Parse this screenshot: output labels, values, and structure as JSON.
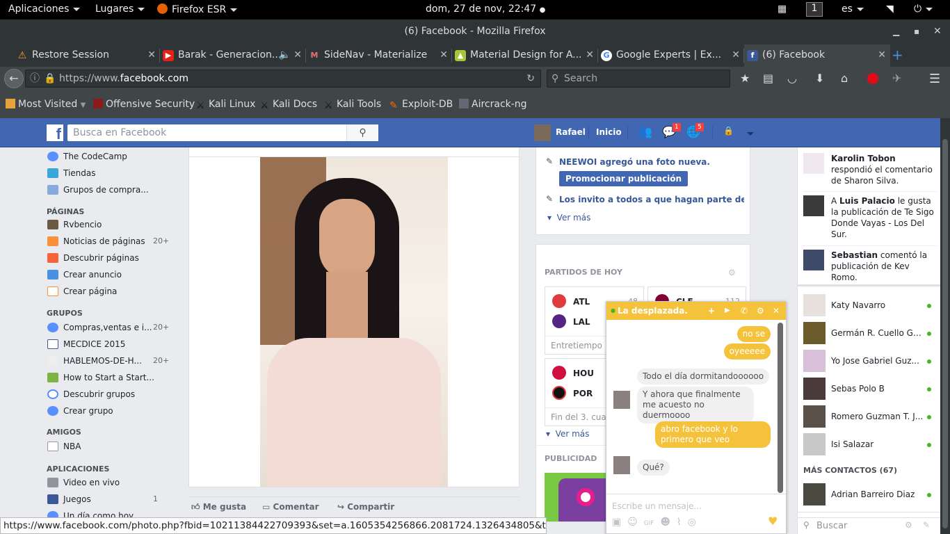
{
  "topbar": {
    "applications": "Aplicaciones",
    "places": "Lugares",
    "firefox": "Firefox ESR",
    "clock": "dom, 27 de nov, 22:47",
    "workspace": "1",
    "lang": "es"
  },
  "window": {
    "title": "(6) Facebook - Mozilla Firefox"
  },
  "tabs": [
    {
      "label": "Restore Session"
    },
    {
      "label": "Barak - Generacion..."
    },
    {
      "label": "SideNav - Materialize"
    },
    {
      "label": "Material Design for A..."
    },
    {
      "label": "Google Experts  |  Ex..."
    },
    {
      "label": "(6) Facebook"
    }
  ],
  "nav": {
    "url_prefix": "https://www.",
    "url_domain": "facebook.com",
    "search_placeholder": "Search"
  },
  "bookmarks": [
    {
      "label": "Most Visited"
    },
    {
      "label": "Offensive Security"
    },
    {
      "label": "Kali Linux"
    },
    {
      "label": "Kali Docs"
    },
    {
      "label": "Kali Tools"
    },
    {
      "label": "Exploit-DB"
    },
    {
      "label": "Aircrack-ng"
    }
  ],
  "fb": {
    "search_placeholder": "Busca en Facebook",
    "user": "Rafael",
    "home": "Inicio",
    "badge_messages": "1",
    "badge_notifications": "5"
  },
  "left": {
    "items_top": [
      {
        "label": "The CodeCamp",
        "count": ""
      },
      {
        "label": "Tiendas",
        "count": ""
      },
      {
        "label": "Grupos de compra...",
        "count": ""
      }
    ],
    "pages_header": "PÁGINAS",
    "pages": [
      {
        "label": "Rvbencio",
        "count": ""
      },
      {
        "label": "Noticias de páginas",
        "count": "20+"
      },
      {
        "label": "Descubrir páginas",
        "count": ""
      },
      {
        "label": "Crear anuncio",
        "count": ""
      },
      {
        "label": "Crear página",
        "count": ""
      }
    ],
    "groups_header": "GRUPOS",
    "groups": [
      {
        "label": "Compras,ventas e i...",
        "count": "20+"
      },
      {
        "label": "MECDICE 2015",
        "count": ""
      },
      {
        "label": "HABLEMOS-DE-H...",
        "count": "20+"
      },
      {
        "label": "How to Start a Start...",
        "count": ""
      },
      {
        "label": "Descubrir grupos",
        "count": ""
      },
      {
        "label": "Crear grupo",
        "count": ""
      }
    ],
    "friends_header": "AMIGOS",
    "friends": [
      {
        "label": "NBA",
        "count": ""
      }
    ],
    "apps_header": "APLICACIONES",
    "apps": [
      {
        "label": "Video en vivo",
        "count": ""
      },
      {
        "label": "Juegos",
        "count": "1"
      },
      {
        "label": "Un día como hoy",
        "count": "3"
      }
    ]
  },
  "post": {
    "like": "Me gusta",
    "comment": "Comentar",
    "share": "Compartir"
  },
  "right": {
    "page_update": "NEEWOI agregó una foto nueva.",
    "promote": "Promocionar publicación",
    "invite": "Los invito a todos a que hagan parte de el gr...",
    "see_more": "Ver más",
    "games_header": "PARTIDOS DE HOY",
    "games": [
      {
        "team1": "ATL",
        "score1": "48",
        "team2": "LAL",
        "status": "Entretiempo"
      },
      {
        "team1": "CLE",
        "score1": "112",
        "team2": "",
        "status": ""
      },
      {
        "team1": "HOU",
        "score1": "",
        "team2": "POR",
        "status": "Fin del 3. cuart"
      }
    ],
    "see_more2": "Ver más",
    "ads_header": "PUBLICIDAD"
  },
  "ticker": [
    {
      "name": "Karolin Tobon",
      "text": " respondió el comentario de Sharon Silva."
    },
    {
      "pre": "A ",
      "name": "Luis Palacio",
      "text": " le gusta la publicación de Te Sigo Donde Vayas - Los Del Sur."
    },
    {
      "name": "Sebastian",
      "text": " comentó la publicación de Kev Romo."
    }
  ],
  "contacts": [
    {
      "name": "Katy Navarro"
    },
    {
      "name": "Germán R. Cuello Gu..."
    },
    {
      "name": "Yo Jose Gabriel Guz..."
    },
    {
      "name": "Sebas Polo B"
    },
    {
      "name": "Romero Guzman T. J..."
    },
    {
      "name": "Isi Salazar"
    }
  ],
  "more_contacts": "MÁS CONTACTOS (67)",
  "more_contacts_list": [
    {
      "name": "Adrian Barreiro Diaz"
    }
  ],
  "sidebar_search": "Buscar",
  "chat": {
    "title": "La desplazada.",
    "messages": [
      {
        "from": "me",
        "text": "no se"
      },
      {
        "from": "me",
        "text": "oyeeeee"
      },
      {
        "from": "them",
        "text": "Todo el día dormitandoooooo"
      },
      {
        "from": "them",
        "text": "Y ahora que finalmente me acuesto no duermoooo"
      },
      {
        "from": "me",
        "text": "abro facebook y lo primero que veo"
      },
      {
        "from": "them",
        "text": "Qué?"
      }
    ],
    "input_placeholder": "Escribe un mensaje..."
  },
  "status_url": "https://www.facebook.com/photo.php?fbid=10211384422709393&set=a.1605354256866.2081724.1326434805&type=3",
  "colors": {
    "fb_blue": "#4267b2",
    "chat_yellow": "#f5c33b",
    "online_green": "#42b72a",
    "badge_red": "#fa3e3e"
  }
}
